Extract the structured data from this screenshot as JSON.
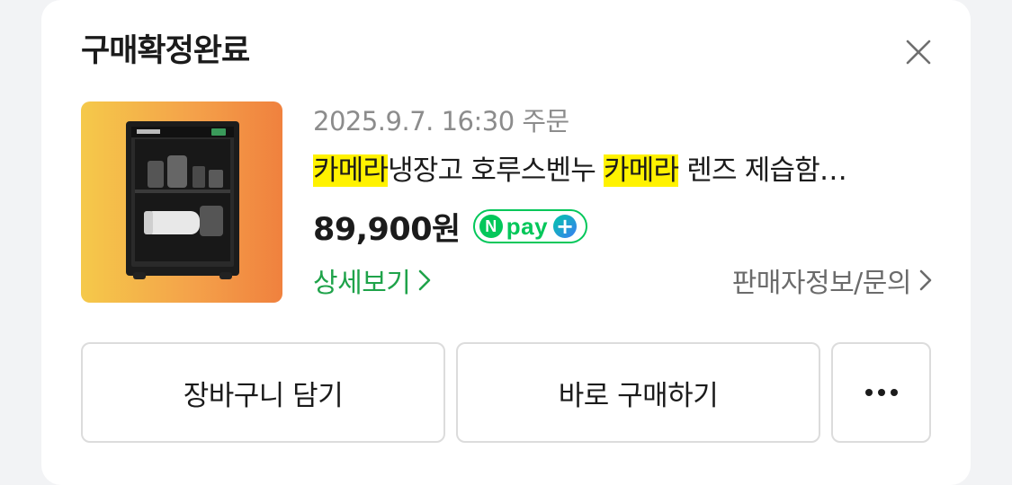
{
  "header": {
    "title": "구매확정완료"
  },
  "order": {
    "date_label": "2025.9.7. 16:30 주문",
    "product_name_parts": {
      "hl1": "카메라",
      "mid": "냉장고 호루스벤누 ",
      "hl2": "카메라",
      "tail": " 렌즈 제습함…"
    },
    "price": "89,900원",
    "pay_badge": {
      "n": "N",
      "text": "pay",
      "plus": "+"
    },
    "detail_link": "상세보기",
    "seller_link": "판매자정보/문의"
  },
  "actions": {
    "cart_label": "장바구니 담기",
    "buy_label": "바로 구매하기"
  },
  "colors": {
    "highlight": "#fff200",
    "link_green": "#1fa34a",
    "npay_green": "#03c75a"
  },
  "icons": {
    "close": "close-icon",
    "chevron": "chevron-right-icon",
    "more": "more-dots-icon"
  }
}
